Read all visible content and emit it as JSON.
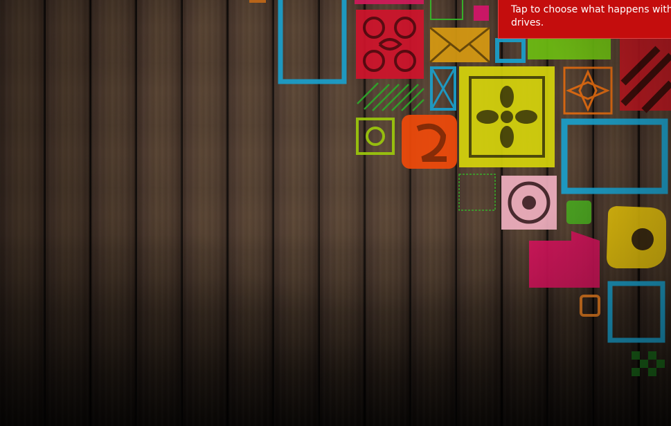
{
  "notification": {
    "message_line1": "Tap to choose what happens with re",
    "message_line2": "drives.",
    "background_color": "#c40d0d"
  },
  "wallpaper": {
    "description_icon": "wood-plank-wallpaper"
  }
}
